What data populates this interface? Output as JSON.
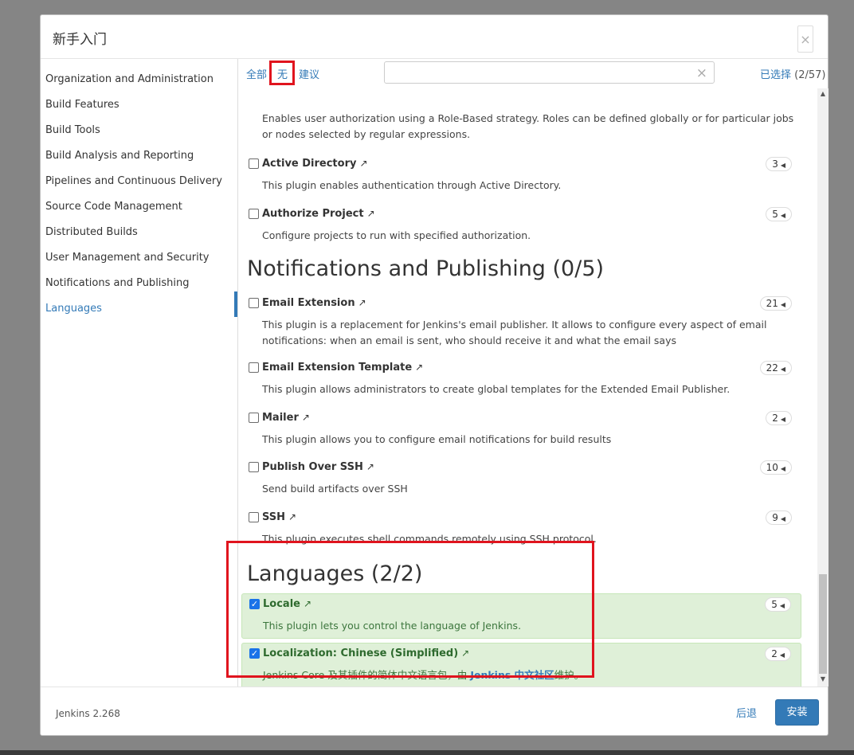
{
  "dialog": {
    "title": "新手入门",
    "close": "×"
  },
  "sidebar": {
    "items": [
      {
        "label": "Organization and Administration"
      },
      {
        "label": "Build Features"
      },
      {
        "label": "Build Tools"
      },
      {
        "label": "Build Analysis and Reporting"
      },
      {
        "label": "Pipelines and Continuous Delivery"
      },
      {
        "label": "Source Code Management"
      },
      {
        "label": "Distributed Builds"
      },
      {
        "label": "User Management and Security"
      },
      {
        "label": "Notifications and Publishing"
      },
      {
        "label": "Languages",
        "active": true
      }
    ]
  },
  "toolbar": {
    "all": "全部",
    "none": "无",
    "suggested": "建议",
    "separator": "|",
    "search_placeholder": "",
    "search_clear": "×",
    "selected_label": "已选择",
    "selected_count": "(2/57)"
  },
  "plugins": {
    "role_strategy": {
      "desc": "Enables user authorization using a Role-Based strategy. Roles can be defined globally or for particular jobs or nodes selected by regular expressions."
    },
    "active_directory": {
      "name": "Active Directory",
      "desc": "This plugin enables authentication through Active Directory.",
      "deps": "3",
      "checked": false
    },
    "authorize_project": {
      "name": "Authorize Project",
      "desc": "Configure projects to run with specified authorization.",
      "deps": "5",
      "checked": false
    },
    "email_extension": {
      "name": "Email Extension",
      "desc": "This plugin is a replacement for Jenkins's email publisher. It allows to configure every aspect of email notifications: when an email is sent, who should receive it and what the email says",
      "deps": "21",
      "checked": false
    },
    "email_extension_template": {
      "name": "Email Extension Template",
      "desc": "This plugin allows administrators to create global templates for the Extended Email Publisher.",
      "deps": "22",
      "checked": false
    },
    "mailer": {
      "name": "Mailer",
      "desc": "This plugin allows you to configure email notifications for build results",
      "deps": "2",
      "checked": false
    },
    "publish_over_ssh": {
      "name": "Publish Over SSH",
      "desc": "Send build artifacts over SSH",
      "deps": "10",
      "checked": false
    },
    "ssh": {
      "name": "SSH",
      "desc": "This plugin executes shell commands remotely using SSH protocol.",
      "deps": "9",
      "checked": false
    },
    "locale": {
      "name": "Locale",
      "desc": "This plugin lets you control the language of Jenkins.",
      "deps": "5",
      "checked": true
    },
    "localization_zh_cn": {
      "name": "Localization: Chinese (Simplified)",
      "desc_prefix": "Jenkins Core 及其插件的简体中文语言包，由 ",
      "desc_link": "Jenkins 中文社区",
      "desc_suffix": "维护。",
      "deps": "2",
      "checked": true
    }
  },
  "sections": {
    "notifications": "Notifications and Publishing (0/5)",
    "languages": "Languages (2/2)"
  },
  "icons": {
    "external_link": "↗",
    "badge_arrow": "◀",
    "checkmark": "✓",
    "scroll_up": "▲",
    "scroll_down": "▼"
  },
  "footer": {
    "version": "Jenkins 2.268",
    "back": "后退",
    "install": "安装"
  },
  "colors": {
    "link": "#337ab7",
    "selected_bg": "#dff0d8",
    "highlight": "#e0141e"
  }
}
